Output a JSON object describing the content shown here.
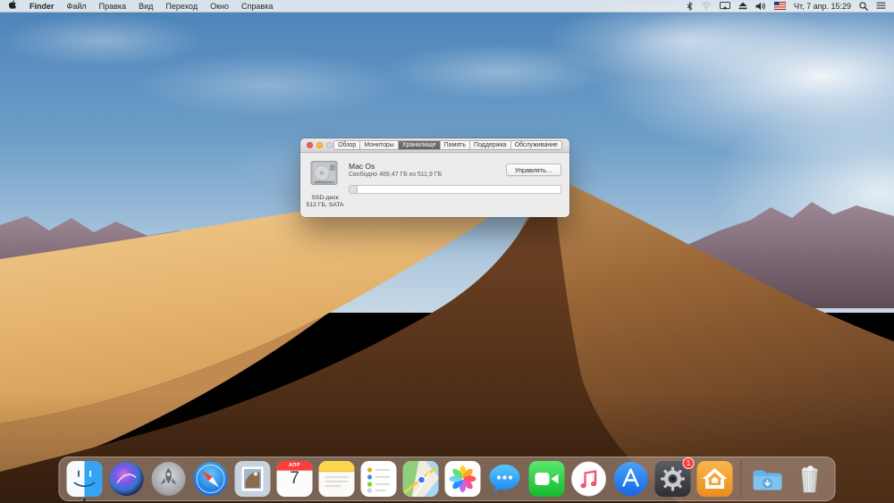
{
  "menubar": {
    "menus": [
      "Finder",
      "Файл",
      "Правка",
      "Вид",
      "Переход",
      "Окно",
      "Справка"
    ],
    "status_icons": [
      "bluetooth",
      "wifi",
      "display-mirroring",
      "eject",
      "volume",
      "keyboard-flag"
    ],
    "clock": "Чт, 7 апр. 15:29"
  },
  "about_window": {
    "tabs": [
      {
        "label": "Обзор",
        "selected": false
      },
      {
        "label": "Мониторы",
        "selected": false
      },
      {
        "label": "Хранилище",
        "selected": true
      },
      {
        "label": "Память",
        "selected": false
      },
      {
        "label": "Поддержка",
        "selected": false
      },
      {
        "label": "Обслуживание",
        "selected": false
      }
    ],
    "disk": {
      "name": "Mac Os",
      "free_text": "Свободно 489,47 ГБ из 511,9 ГБ",
      "type_label": "SSD-диск",
      "spec_label": "512 ГБ, SATA",
      "used_percent": 4.4
    },
    "manage_button_label": "Управлять…"
  },
  "dock": {
    "apps": [
      "finder",
      "siri",
      "launchpad",
      "safari",
      "mail",
      "calendar",
      "notes",
      "reminders",
      "maps",
      "photos",
      "messages",
      "facetime",
      "itunes",
      "app-store",
      "system-preferences",
      "home"
    ],
    "right_items": [
      "downloads-folder",
      "trash"
    ],
    "calendar_month": "АПР",
    "calendar_day": "7",
    "system_preferences_badge": "1",
    "running_apps": [
      "finder"
    ]
  },
  "colors": {
    "sky_blue": "#4d84ba",
    "sand_bright": "#eec383",
    "sand_dark": "#4a2a17",
    "badge_red": "#fc3d39",
    "selected_tab_gray": "#6a676a"
  }
}
